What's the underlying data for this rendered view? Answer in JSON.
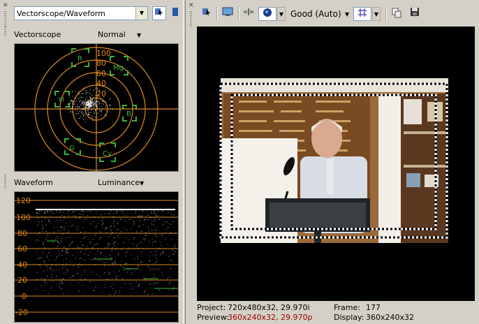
{
  "left_panel": {
    "selector": {
      "value": "Vectorscope/Waveform"
    },
    "vectorscope": {
      "label": "Vectorscope",
      "mode": "Normal",
      "scale_labels": [
        "100",
        "80",
        "60",
        "40",
        "20"
      ],
      "targets": [
        "R",
        "Mg",
        "B",
        "Cy",
        "G",
        "Yl"
      ]
    },
    "waveform": {
      "label": "Waveform",
      "mode": "Luminance",
      "scale_labels": [
        "120",
        "100",
        "80",
        "60",
        "40",
        "20",
        "0",
        "-20"
      ]
    }
  },
  "right_panel": {
    "quality": {
      "value": "Good (Auto)"
    },
    "info": {
      "project_label": "Project:",
      "project_value": "720x480x32, 29.970i",
      "preview_label": "Preview:",
      "preview_value": "360x240x32, 29.970p",
      "frame_label": "Frame:",
      "frame_value": "177",
      "display_label": "Display:",
      "display_value": "360x240x32"
    }
  },
  "colors": {
    "scope_background": "#000000",
    "graticule": "#e08a1e",
    "target_boxes": "#3fb23f",
    "trace": "#ffffff",
    "preview_value": "#a00000"
  }
}
